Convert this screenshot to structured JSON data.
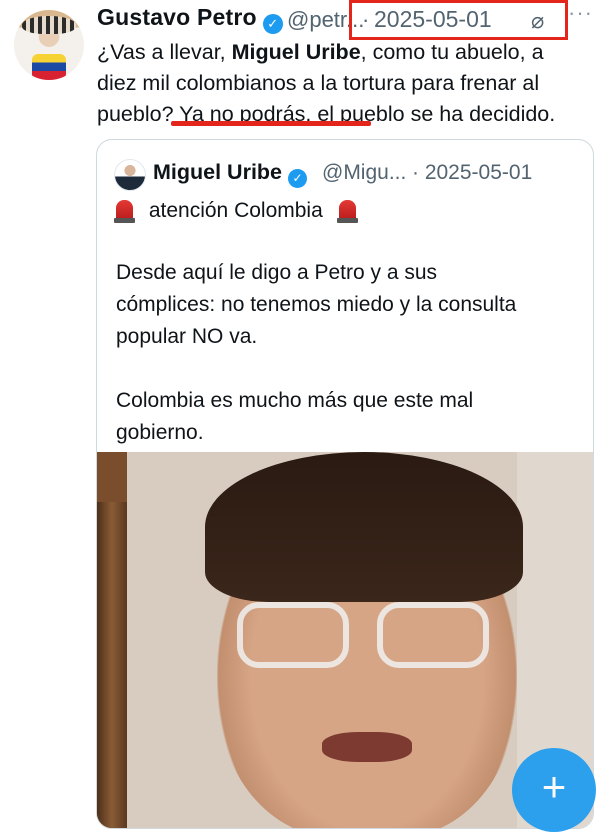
{
  "author": {
    "name": "Gustavo Petro",
    "handle": "@petr...",
    "separator": "·",
    "date": "2025-05-01",
    "more": "···"
  },
  "tweet": {
    "line1_a": "¿Vas a llevar, ",
    "line1_b": "Miguel Uribe",
    "line1_c": ", como tu abuelo, a",
    "line2": "diez mil colombianos a la tortura para frenar al",
    "line3": "pueblo? Ya no podrás, el pueblo se ha decidido."
  },
  "quote": {
    "name": "Miguel Uribe",
    "handle": "@Migu...",
    "date": "· 2025-05-01",
    "headline": "atención Colombia",
    "body_line1": "Desde aquí le digo a Petro y a sus",
    "body_line2": "cómplices: no tenemos miedo y la consulta",
    "body_line3": "popular NO va.",
    "body_line4": "Colombia es mucho más que este mal",
    "body_line5": "gobierno."
  },
  "fab": {
    "label": "+"
  },
  "colors": {
    "accent": "#1d9bf0",
    "annotation_red": "#e4251b",
    "muted": "#536471"
  }
}
